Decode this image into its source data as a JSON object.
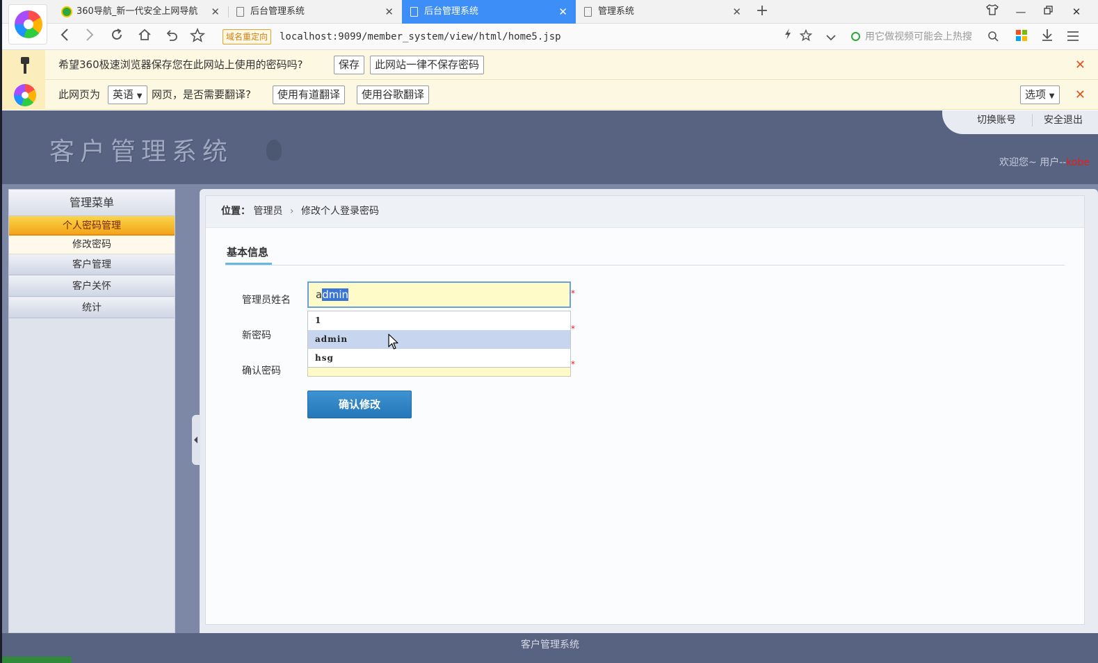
{
  "browser": {
    "tabs": [
      {
        "title": "360导航_新一代安全上网导航",
        "icon": "360-nav-icon",
        "active": false
      },
      {
        "title": "后台管理系统",
        "icon": "document-icon",
        "active": false
      },
      {
        "title": "后台管理系统",
        "icon": "document-icon",
        "active": true
      },
      {
        "title": "管理系统",
        "icon": "document-icon",
        "active": false
      }
    ],
    "new_tab": "+",
    "redirect_badge": "域名重定向",
    "url": "localhost:9099/member_system/view/html/home5.jsp",
    "search_placeholder": "用它做视频可能会上热搜",
    "active_tab_color": "#3e8ef7"
  },
  "password_bar": {
    "message": "希望360极速浏览器保存您在此网站上使用的密码吗?",
    "save_button": "保存",
    "never_button": "此网站一律不保存密码",
    "close": "✕"
  },
  "translate_bar": {
    "prefix": "此网页为",
    "language": "英语",
    "suffix": "网页，是否需要翻译?",
    "youdao_button": "使用有道翻译",
    "google_button": "使用谷歌翻译",
    "options_button": "选项",
    "close": "✕"
  },
  "header": {
    "app_title": "客户管理系统",
    "switch_account": "切换账号",
    "logout": "安全退出",
    "welcome_prefix": "欢迎您~ 用户--",
    "username": "kobe"
  },
  "sidebar": {
    "title": "管理菜单",
    "items": [
      {
        "label": "个人密码管理",
        "state": "active-group"
      },
      {
        "label": "修改密码",
        "state": "sub-item"
      },
      {
        "label": "客户管理",
        "state": "group"
      },
      {
        "label": "客户关怀",
        "state": "group"
      },
      {
        "label": "统计",
        "state": "group"
      }
    ]
  },
  "breadcrumb": {
    "label": "位置：",
    "items": [
      "管理员",
      "修改个人登录密码"
    ],
    "separator": "›"
  },
  "form": {
    "section_tab": "基本信息",
    "fields": [
      {
        "label": "管理员姓名",
        "value_unselected": "a",
        "value_selected": "dmin",
        "required_mark": "*"
      },
      {
        "label": "新密码",
        "value": "",
        "required_mark": "*"
      },
      {
        "label": "确认密码",
        "value": "•••",
        "required_mark": "*"
      }
    ],
    "autocomplete_options": [
      "1",
      "admin",
      "hsg"
    ],
    "hovered_option": "admin",
    "submit_button": "确认修改",
    "input_background": "#fffbc9"
  },
  "footer": {
    "text": "客户管理系统"
  }
}
